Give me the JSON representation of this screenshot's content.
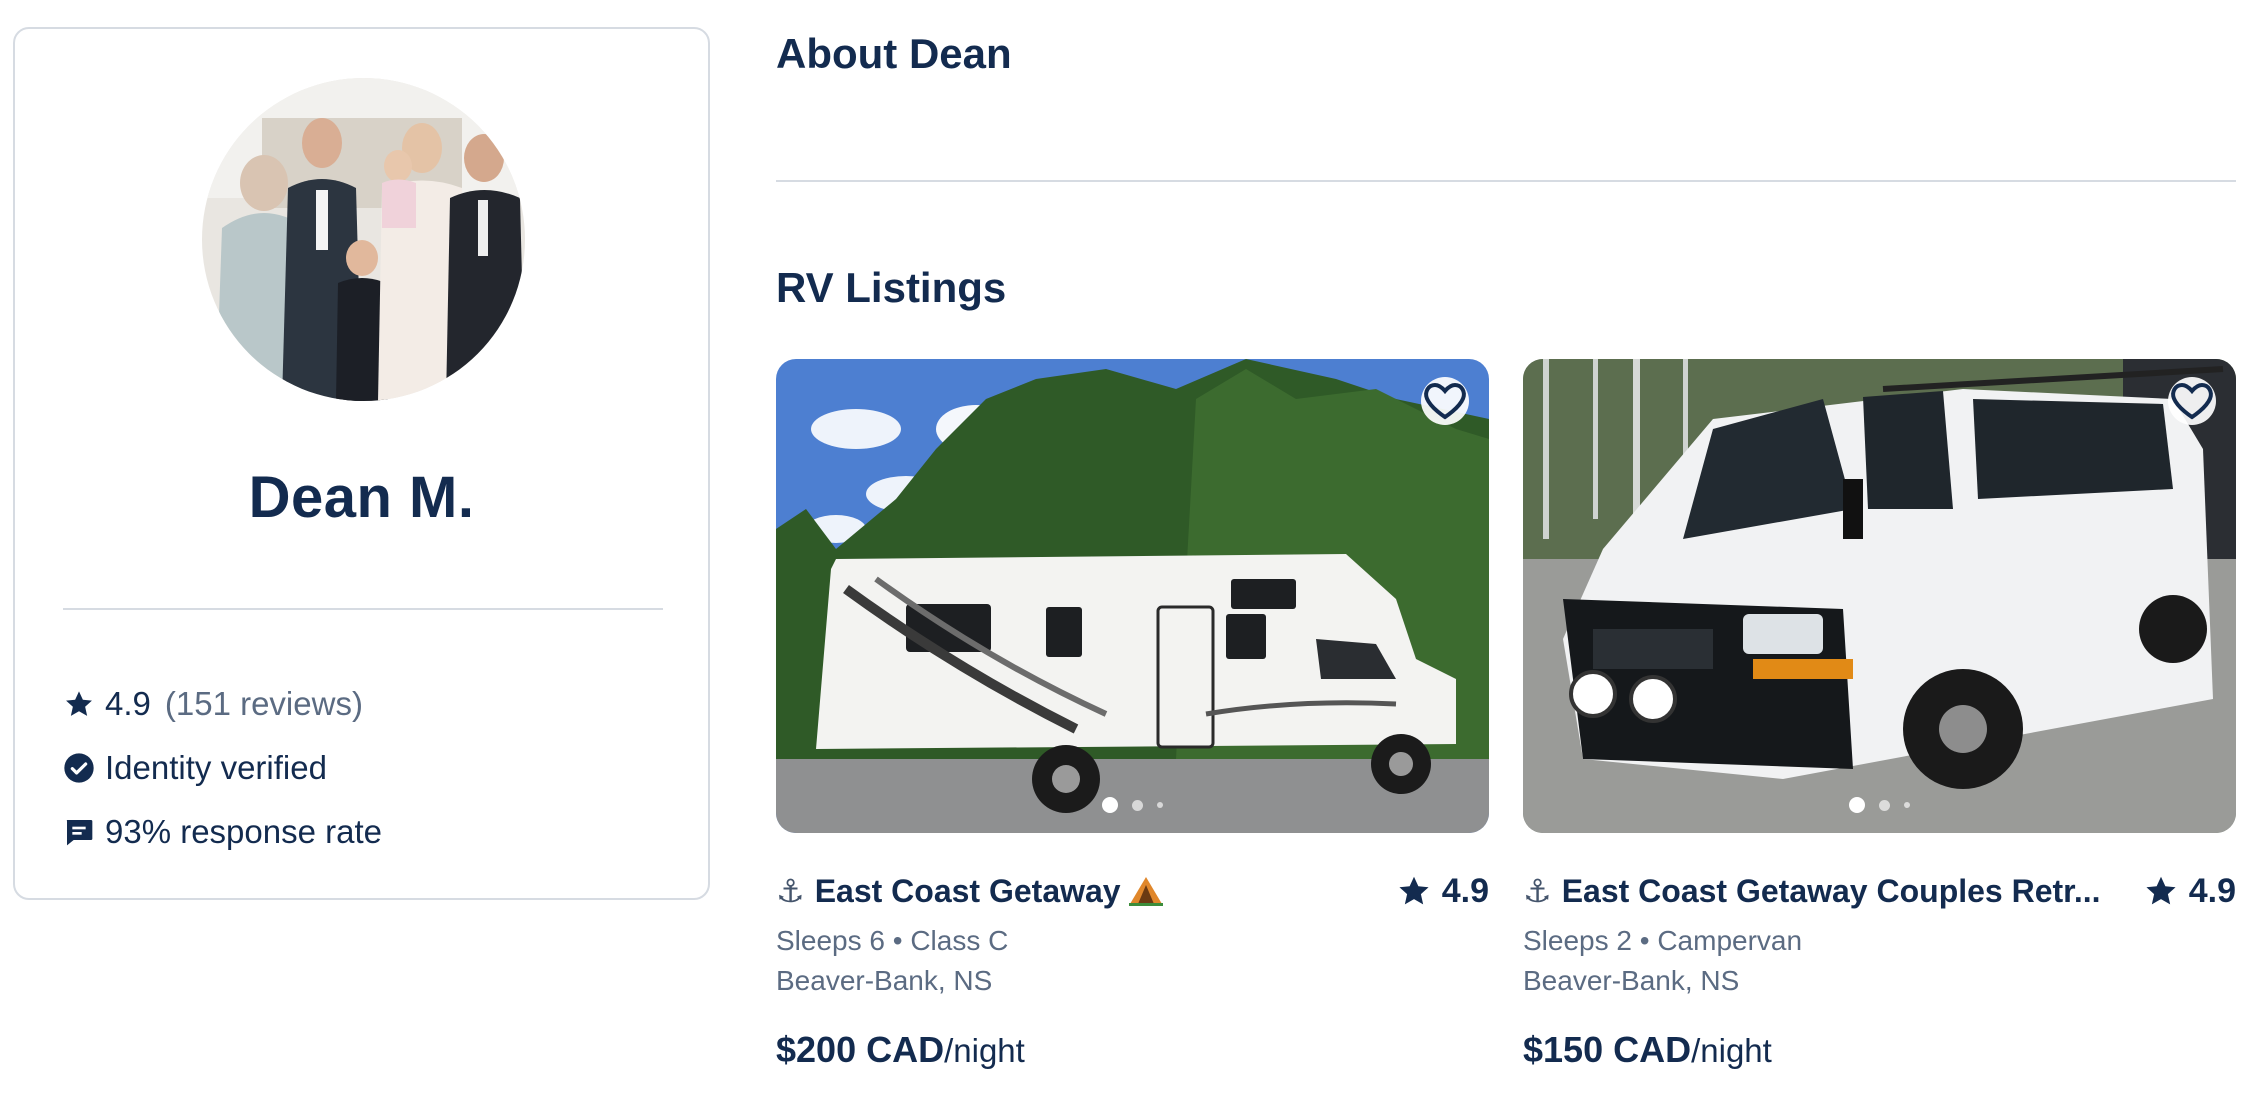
{
  "host": {
    "name": "Dean M.",
    "rating": "4.9",
    "reviews": "(151 reviews)",
    "identity": "Identity verified",
    "response": "93% response rate"
  },
  "about": {
    "title": "About Dean"
  },
  "listings_section": {
    "title": "RV Listings"
  },
  "listings": [
    {
      "title": "East Coast Getaway",
      "rating": "4.9",
      "specs": "Sleeps 6 • Class C",
      "location": "Beaver-Bank, NS",
      "price": "$200 CAD",
      "unit": "/night"
    },
    {
      "title": "East Coast Getaway Couples Retr...",
      "rating": "4.9",
      "specs": "Sleeps 2 • Campervan",
      "location": "Beaver-Bank, NS",
      "price": "$150 CAD",
      "unit": "/night"
    }
  ],
  "icons": {
    "anchor": "⚓",
    "star": "star-icon",
    "verified": "check-badge-icon",
    "response": "chat-icon",
    "favorite": "heart-icon"
  },
  "colors": {
    "navy": "#132b4f",
    "muted": "#5b6b82",
    "border": "#d6dbe2"
  }
}
